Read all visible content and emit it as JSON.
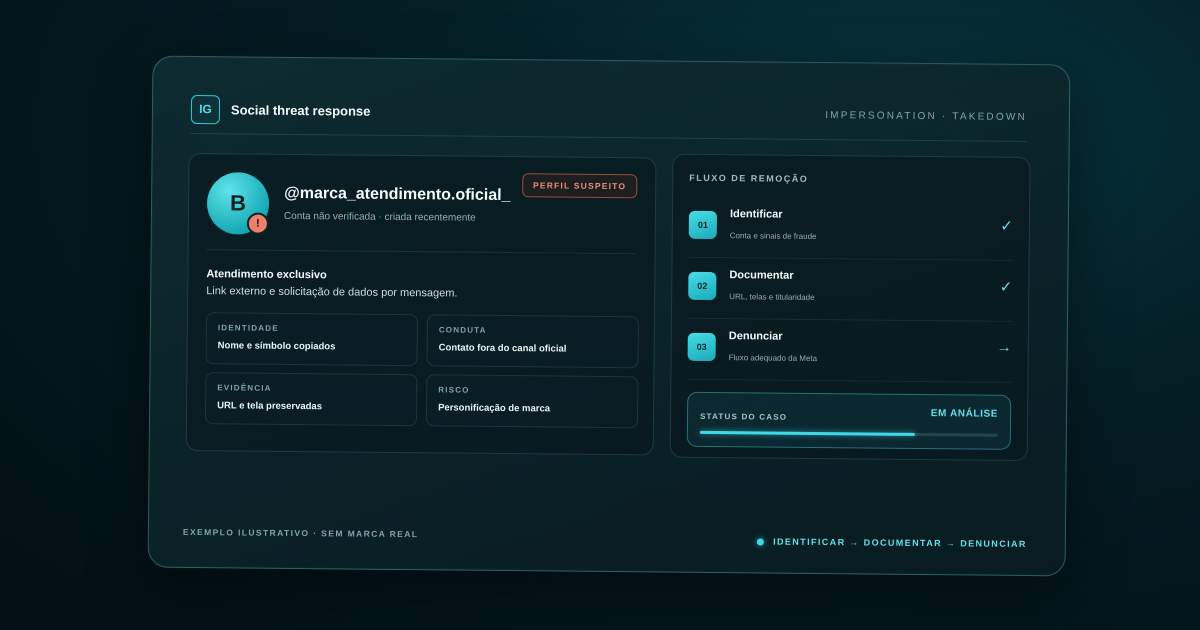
{
  "header": {
    "logo": "IG",
    "title": "Social threat response",
    "context": "IMPERSONATION · TAKEDOWN"
  },
  "profile": {
    "avatar_letter": "B",
    "warning_glyph": "!",
    "handle": "@marca_atendimento.oficial_",
    "meta": "Conta não verificada · criada recentemente",
    "badge": "PERFIL SUSPEITO",
    "bio_title": "Atendimento exclusivo",
    "bio_text": "Link externo e solicitação de dados por mensagem.",
    "facts": [
      {
        "label": "IDENTIDADE",
        "value": "Nome e símbolo copiados"
      },
      {
        "label": "CONDUTA",
        "value": "Contato fora do canal oficial"
      },
      {
        "label": "EVIDÊNCIA",
        "value": "URL e tela preservadas"
      },
      {
        "label": "RISCO",
        "value": "Personificação de marca"
      }
    ]
  },
  "flow": {
    "title": "FLUXO DE REMOÇÃO",
    "steps": [
      {
        "number": "01",
        "title": "Identificar",
        "subtitle": "Conta e sinais de fraude",
        "state": "done",
        "icon": "✓"
      },
      {
        "number": "02",
        "title": "Documentar",
        "subtitle": "URL, telas e titularidade",
        "state": "done",
        "icon": "✓"
      },
      {
        "number": "03",
        "title": "Denunciar",
        "subtitle": "Fluxo adequado da Meta",
        "state": "next",
        "icon": "→"
      }
    ],
    "status": {
      "label": "STATUS DO CASO",
      "value": "EM ANÁLISE",
      "progress": 0.72
    }
  },
  "footer": {
    "disclaimer": "EXEMPLO ILUSTRATIVO · SEM MARCA REAL",
    "flow": "IDENTIFICAR → DOCUMENTAR → DENUNCIAR"
  },
  "colors": {
    "accent": "#3fd8e6",
    "warning": "#f0806c",
    "background": "#031c22"
  }
}
